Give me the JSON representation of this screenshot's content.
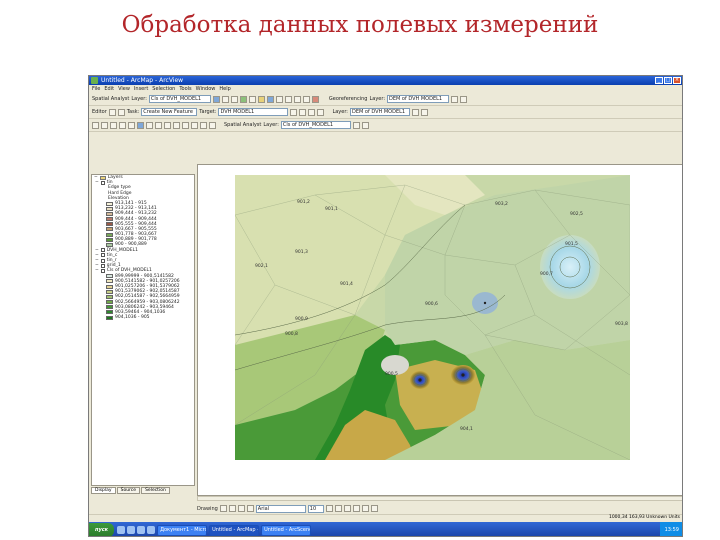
{
  "slide_title": "Обработка данных полевых измерений",
  "window": {
    "title": "Untitled - ArcMap - ArcView"
  },
  "menu": [
    "File",
    "Edit",
    "View",
    "Insert",
    "Selection",
    "Tools",
    "Window",
    "Help"
  ],
  "toolbars": {
    "spatial_analyst": {
      "label": "Spatial Analyst",
      "layer_label": "Layer:",
      "layer_value": "Cls of DVH_MODEL1"
    },
    "editor": {
      "label": "Editor",
      "task_label": "Task:",
      "task_value": "Create New Feature",
      "target_label": "Target:",
      "target_value": "DVH MODEL1"
    },
    "georef": {
      "label": "Georeferencing",
      "layer_label": "Layer:",
      "layer_value": "DEM of DVH MODEL1"
    },
    "tin": {
      "label": "Spatial Analyst",
      "layer_label": "Layer:",
      "layer_value": "Cls of DVH_MODEL1"
    },
    "layer_blank": {
      "label": "Layer:",
      "value": "DEM of DVH MODEL1"
    }
  },
  "toc": {
    "root": "Layers",
    "rows": [
      {
        "kind": "layer",
        "text": "tin"
      },
      {
        "kind": "sub",
        "text": "Edge type"
      },
      {
        "kind": "sub",
        "text": "Hard Edge"
      },
      {
        "kind": "sub",
        "text": "Elevation"
      },
      {
        "kind": "item",
        "text": "913,141 - 915",
        "color": "#f5f0d8"
      },
      {
        "kind": "item",
        "text": "913,232 - 913,141",
        "color": "#e8dcc0"
      },
      {
        "kind": "item",
        "text": "909,444 - 913,232",
        "color": "#d4b99a"
      },
      {
        "kind": "item",
        "text": "909,444 - 909,444",
        "color": "#b87a6a"
      },
      {
        "kind": "item",
        "text": "905,555 - 909,444",
        "color": "#9a5a48"
      },
      {
        "kind": "item",
        "text": "903,667 - 905,555",
        "color": "#c4a070"
      },
      {
        "kind": "item",
        "text": "901,778 - 903,667",
        "color": "#78a85a"
      },
      {
        "kind": "item",
        "text": "900,889 - 901,778",
        "color": "#5a9a3a"
      },
      {
        "kind": "item",
        "text": "900 - 900,889",
        "color": "#a8c8a0"
      },
      {
        "kind": "layer",
        "text": "DVH_MODEL1"
      },
      {
        "kind": "layer",
        "text": "tin_c"
      },
      {
        "kind": "layer",
        "text": "tin_r"
      },
      {
        "kind": "layer",
        "text": "grid_1"
      },
      {
        "kind": "layer",
        "text": "Cls of DVH_MODEL1"
      },
      {
        "kind": "item",
        "text": "899,99999 - 900,5141582",
        "color": "#d8e8e0"
      },
      {
        "kind": "item",
        "text": "900,5141582 - 901,0257206",
        "color": "#f0e8c0"
      },
      {
        "kind": "item",
        "text": "901,0257206 - 901,5379062",
        "color": "#e0d090"
      },
      {
        "kind": "item",
        "text": "901,5379062 - 902,0514587",
        "color": "#c8d088"
      },
      {
        "kind": "item",
        "text": "902,0514587 - 902,5664959",
        "color": "#a0c070"
      },
      {
        "kind": "item",
        "text": "902,5664959 - 903,0806242",
        "color": "#70a848"
      },
      {
        "kind": "item",
        "text": "903,0806242 - 903,59464",
        "color": "#489838"
      },
      {
        "kind": "item",
        "text": "903,59464 - 904,1036",
        "color": "#308830"
      },
      {
        "kind": "item",
        "text": "904,1036 - 905",
        "color": "#207820"
      }
    ]
  },
  "toc_tabs": [
    "Display",
    "Source",
    "Selection"
  ],
  "map_labels": [
    "901,2",
    "901,1",
    "901,3",
    "902,1",
    "900,9",
    "900,8",
    "901,4",
    "903,2",
    "902,5",
    "901,5",
    "900,7",
    "900,6",
    "900,5",
    "904,1",
    "903,8"
  ],
  "draw_toolbar": {
    "label": "Drawing",
    "font": "Arial",
    "size": "10"
  },
  "status": {
    "coords": "1000,34  163,93 Unknown Units"
  },
  "taskbar": {
    "start": "пуск",
    "buttons": [
      "Документ1 - Microsoft Word",
      "Untitled - ArcMap - ArcView",
      "Untitled - ArcScene - ArcView"
    ],
    "clock": "13:59"
  },
  "colors": {
    "title": "#b3262a",
    "titlebar": "#0a3fb0",
    "taskbar": "#245edb"
  }
}
